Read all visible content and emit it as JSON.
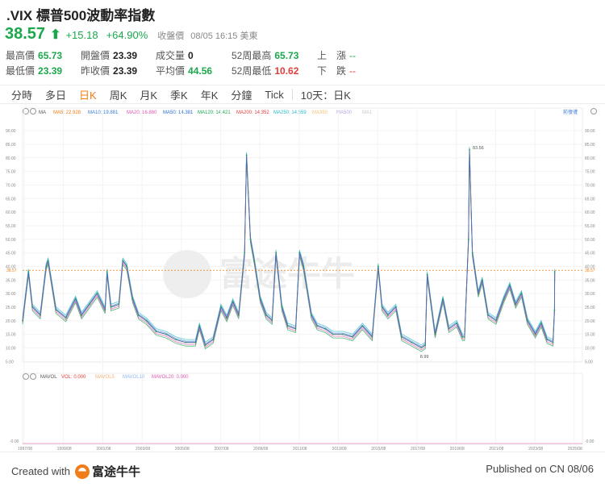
{
  "header": {
    "title": ".VIX 標普500波動率指數",
    "price": "38.57",
    "change": "+15.18",
    "change_pct": "+64.90%",
    "close_label": "收盤價",
    "close_time": "08/05 16:15 美東"
  },
  "stats": [
    {
      "label": "最高價",
      "value": "65.73",
      "color": "green"
    },
    {
      "label": "開盤價",
      "value": "23.39",
      "color": "plain"
    },
    {
      "label": "成交量",
      "value": "0",
      "color": "plain"
    },
    {
      "label": "52周最高",
      "value": "65.73",
      "color": "green"
    },
    {
      "label": "上　漲",
      "value": "--",
      "color": "dashg"
    },
    {
      "label": "最低價",
      "value": "23.39",
      "color": "green"
    },
    {
      "label": "昨收價",
      "value": "23.39",
      "color": "plain"
    },
    {
      "label": "平均價",
      "value": "44.56",
      "color": "green"
    },
    {
      "label": "52周最低",
      "value": "10.62",
      "color": "red"
    },
    {
      "label": "下　跌",
      "value": "--",
      "color": "dash"
    }
  ],
  "tabs": [
    "分時",
    "多日",
    "日K",
    "周K",
    "月K",
    "季K",
    "年K",
    "分鐘",
    "Tick",
    "10天：日K"
  ],
  "active_tab": "日K",
  "ma_legend": [
    {
      "label": "MA",
      "color": "#555555"
    },
    {
      "label": "MA5: 22.928",
      "color": "#f07d19"
    },
    {
      "label": "MA10: 19.881",
      "color": "#3a7bd5"
    },
    {
      "label": "MA20: 16.880",
      "color": "#e056b0"
    },
    {
      "label": "MA50: 14.381",
      "color": "#2a6fd6"
    },
    {
      "label": "MA120: 14.421",
      "color": "#1aa84b"
    },
    {
      "label": "MA200: 14.352",
      "color": "#e43b3b"
    },
    {
      "label": "MA250: 14.559",
      "color": "#27b9c9"
    },
    {
      "label": "MA350",
      "color": "#f4c27a"
    },
    {
      "label": "MA500",
      "color": "#b9a6e6"
    },
    {
      "label": "MA1",
      "color": "#c9c9c9"
    }
  ],
  "pre_market_label": "前復權",
  "vol_legend": [
    {
      "label": "MAVOL",
      "color": "#555555"
    },
    {
      "label": "VOL: 0.000",
      "color": "#e43b3b"
    },
    {
      "label": "MAVOL5",
      "color": "#f4b27a"
    },
    {
      "label": "MAVOL10",
      "color": "#8fb6f0"
    },
    {
      "label": "MAVOL20: 0.000",
      "color": "#e056b0"
    }
  ],
  "watermark": "富途牛牛",
  "peak_label": "83.56",
  "low_label": "8.99",
  "current_label": "38.57",
  "vol_axis": [
    "0.00",
    "-0.00"
  ],
  "chart_data": {
    "type": "line",
    "title": ".VIX 標普500波動率指數",
    "y_ticks": [
      "5.00",
      "10.00",
      "15.00",
      "20.00",
      "25.00",
      "30.00",
      "35.00",
      "40.00",
      "45.00",
      "50.00",
      "55.00",
      "60.00",
      "65.00",
      "70.00",
      "75.00",
      "80.00",
      "85.00",
      "90.00"
    ],
    "ylim": [
      3,
      93
    ],
    "x_ticks": [
      "1997/08",
      "1999/08",
      "2001/08",
      "2003/08",
      "2005/08",
      "2007/08",
      "2009/08",
      "2011/08",
      "2013/08",
      "2015/08",
      "2017/08",
      "2019/08",
      "2021/08",
      "2023/08",
      "2025/08"
    ],
    "xlim": [
      1997.5,
      2026.0
    ],
    "series": [
      {
        "name": "VIX",
        "x": [
          1997.5,
          1997.8,
          1998.0,
          1998.4,
          1998.7,
          1998.8,
          1999.2,
          1999.7,
          2000.2,
          2000.5,
          2000.9,
          2001.3,
          2001.7,
          2001.8,
          2002.0,
          2002.4,
          2002.6,
          2002.8,
          2003.1,
          2003.4,
          2003.8,
          2004.3,
          2004.8,
          2005.3,
          2005.8,
          2006.3,
          2006.5,
          2006.8,
          2007.2,
          2007.6,
          2007.9,
          2008.2,
          2008.5,
          2008.8,
          2008.9,
          2009.1,
          2009.3,
          2009.6,
          2009.9,
          2010.2,
          2010.4,
          2010.7,
          2011.0,
          2011.4,
          2011.6,
          2011.8,
          2012.2,
          2012.5,
          2012.9,
          2013.3,
          2013.8,
          2014.3,
          2014.8,
          2015.3,
          2015.6,
          2015.8,
          2016.1,
          2016.5,
          2016.8,
          2017.3,
          2017.8,
          2018.0,
          2018.1,
          2018.5,
          2018.9,
          2019.2,
          2019.6,
          2019.9,
          2020.0,
          2020.2,
          2020.25,
          2020.4,
          2020.7,
          2020.9,
          2021.2,
          2021.6,
          2022.0,
          2022.3,
          2022.6,
          2022.9,
          2023.2,
          2023.6,
          2023.9,
          2024.2,
          2024.5,
          2024.58,
          2024.59
        ],
        "values": [
          20,
          38,
          25,
          22,
          40,
          42,
          24,
          21,
          28,
          22,
          26,
          30,
          24,
          38,
          25,
          26,
          42,
          40,
          28,
          22,
          20,
          16,
          15,
          13,
          12,
          12,
          18,
          11,
          13,
          25,
          21,
          27,
          22,
          45,
          81,
          50,
          42,
          28,
          22,
          20,
          45,
          25,
          18,
          17,
          45,
          40,
          22,
          18,
          17,
          15,
          15,
          14,
          18,
          14,
          40,
          25,
          22,
          25,
          14,
          12,
          10,
          11,
          37,
          15,
          28,
          17,
          19,
          14,
          14,
          50,
          83,
          45,
          30,
          35,
          22,
          20,
          28,
          33,
          26,
          30,
          20,
          15,
          19,
          13,
          12,
          24,
          38
        ]
      }
    ]
  }
}
